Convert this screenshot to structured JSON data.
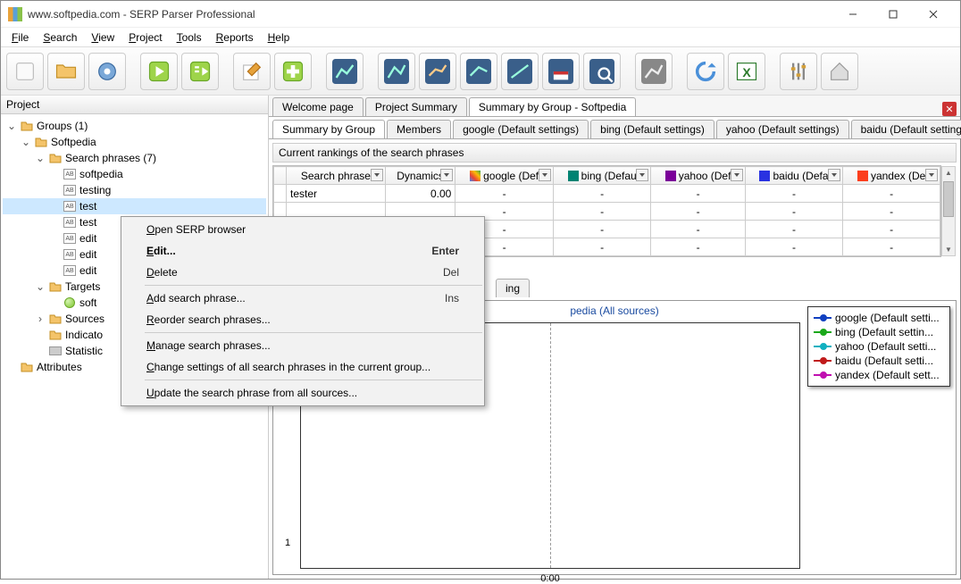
{
  "titlebar": {
    "title": "www.softpedia.com - SERP Parser Professional"
  },
  "menu": {
    "items": [
      "File",
      "Search",
      "View",
      "Project",
      "Tools",
      "Reports",
      "Help"
    ]
  },
  "sidebar": {
    "header": "Project",
    "nodes": {
      "groups": "Groups (1)",
      "softpedia": "Softpedia",
      "search_phrases": "Search phrases (7)",
      "phrase0": "softpedia",
      "phrase1": "testing",
      "phrase2": "test",
      "phrase3": "test",
      "phrase4": "edit",
      "phrase5": "edit",
      "phrase6": "edit",
      "targets": "Targets",
      "target0": "soft",
      "sources": "Sources",
      "indicato": "Indicato",
      "statistic": "Statistic",
      "attributes": "Attributes"
    }
  },
  "tabs_top": {
    "t0": "Welcome page",
    "t1": "Project Summary",
    "t2": "Summary by Group - Softpedia"
  },
  "tabs_inner": {
    "t0": "Summary by Group",
    "t1": "Members",
    "t2": "google (Default settings)",
    "t3": "bing (Default settings)",
    "t4": "yahoo (Default settings)",
    "t5": "baidu (Default settings)"
  },
  "section_title": "Current rankings of the search phrases",
  "grid": {
    "headers": {
      "c0": "Search phrase",
      "c1": "Dynamics",
      "c2": "google (Def",
      "c3": "bing (Defau",
      "c4": "yahoo (Def",
      "c5": "baidu (Defa",
      "c6": "yandex (De"
    },
    "rows": [
      {
        "phrase": "tester",
        "dyn": "0.00",
        "google": "-",
        "bing": "-",
        "yahoo": "-",
        "baidu": "-",
        "yandex": "-"
      },
      {
        "phrase": "",
        "dyn": "",
        "google": "-",
        "bing": "-",
        "yahoo": "-",
        "baidu": "-",
        "yandex": "-"
      },
      {
        "phrase": "",
        "dyn": "",
        "google": "-",
        "bing": "-",
        "yahoo": "-",
        "baidu": "-",
        "yandex": "-"
      },
      {
        "phrase": "",
        "dyn": "",
        "google": "-",
        "bing": "-",
        "yahoo": "-",
        "baidu": "-",
        "yandex": "-"
      }
    ]
  },
  "chart_data": {
    "type": "line",
    "title": "pedia (All sources)",
    "partial_tab": "ing",
    "xticks": [
      "0:00"
    ],
    "yticks": [
      "1"
    ],
    "series": [
      {
        "name": "google (Default setti...",
        "color": "blue",
        "values": []
      },
      {
        "name": "bing (Default settin...",
        "color": "green",
        "values": []
      },
      {
        "name": "yahoo (Default setti...",
        "color": "cyan",
        "values": []
      },
      {
        "name": "baidu (Default setti...",
        "color": "red",
        "values": []
      },
      {
        "name": "yandex (Default sett...",
        "color": "magenta",
        "values": []
      }
    ]
  },
  "context_menu": {
    "m0": "Open SERP browser",
    "m1": "Edit...",
    "m1s": "Enter",
    "m2": "Delete",
    "m2s": "Del",
    "m3": "Add search phrase...",
    "m3s": "Ins",
    "m4": "Reorder search phrases...",
    "m5": "Manage search phrases...",
    "m6": "Change settings of all search phrases in the current group...",
    "m7": "Update the search phrase from all sources..."
  }
}
